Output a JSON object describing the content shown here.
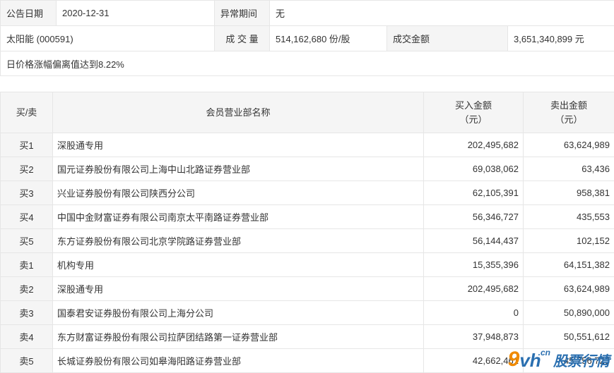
{
  "info": {
    "date_label": "公告日期",
    "date_value": "2020-12-31",
    "abnormal_label": "异常期间",
    "abnormal_value": "无",
    "stock_name": "太阳能 (000591)",
    "volume_label": "成 交 量",
    "volume_value": "514,162,680 份/股",
    "amount_label": "成交金额",
    "amount_value": "3,651,340,899 元",
    "reason": "日价格涨幅偏离值达到8.22%"
  },
  "table": {
    "headers": {
      "side": "买/卖",
      "dept": "会员营业部名称",
      "buy_line1": "买入金额",
      "buy_line2": "（元）",
      "sell_line1": "卖出金额",
      "sell_line2": "（元）"
    },
    "rows": [
      {
        "side": "买1",
        "dept": "深股通专用",
        "buy": "202,495,682",
        "sell": "63,624,989"
      },
      {
        "side": "买2",
        "dept": "国元证券股份有限公司上海中山北路证券营业部",
        "buy": "69,038,062",
        "sell": "63,436"
      },
      {
        "side": "买3",
        "dept": "兴业证券股份有限公司陕西分公司",
        "buy": "62,105,391",
        "sell": "958,381"
      },
      {
        "side": "买4",
        "dept": "中国中金财富证券有限公司南京太平南路证券营业部",
        "buy": "56,346,727",
        "sell": "435,553"
      },
      {
        "side": "买5",
        "dept": "东方证券股份有限公司北京学院路证券营业部",
        "buy": "56,144,437",
        "sell": "102,152"
      },
      {
        "side": "卖1",
        "dept": "机构专用",
        "buy": "15,355,396",
        "sell": "64,151,382"
      },
      {
        "side": "卖2",
        "dept": "深股通专用",
        "buy": "202,495,682",
        "sell": "63,624,989"
      },
      {
        "side": "卖3",
        "dept": "国泰君安证券股份有限公司上海分公司",
        "buy": "0",
        "sell": "50,890,000"
      },
      {
        "side": "卖4",
        "dept": "东方财富证券股份有限公司拉萨团结路第一证券营业部",
        "buy": "37,948,873",
        "sell": "50,551,612"
      },
      {
        "side": "卖5",
        "dept": "长城证券股份有限公司如皋海阳路证券营业部",
        "buy": "42,662,461",
        "sell": "45,756,723"
      }
    ]
  },
  "watermark": {
    "nine": "9",
    "vh": "vh",
    "cn": ".cn",
    "text": "股票行情"
  }
}
